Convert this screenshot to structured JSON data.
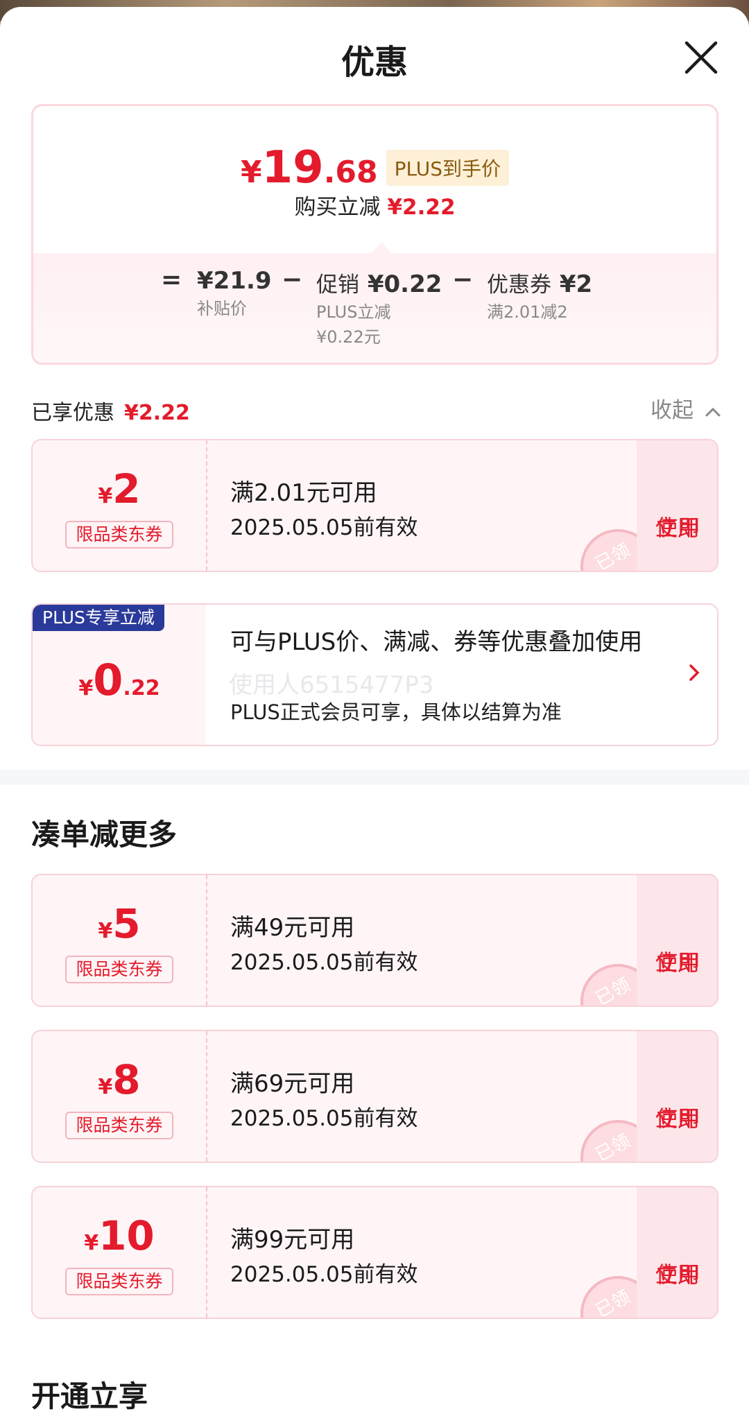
{
  "sheet": {
    "title": "优惠"
  },
  "price_card": {
    "final": {
      "currency": "¥",
      "int": "19",
      "dec": ".68"
    },
    "plus_tag": "PLUS到手价",
    "instant_label": "购买立减",
    "instant_value": "¥2.22",
    "breakdown": {
      "op1": "=",
      "subsidy_value": "¥21.9",
      "subsidy_label": "补贴价",
      "op2": "−",
      "promo_label": "促销",
      "promo_value": "¥0.22",
      "promo_sub1": "PLUS立减",
      "promo_sub2": "¥0.22元",
      "op3": "−",
      "coupon_label": "优惠券",
      "coupon_value": "¥2",
      "coupon_sub": "满2.01减2"
    }
  },
  "enjoyed": {
    "label": "已享优惠",
    "value": "¥2.22",
    "collapse_label": "收起"
  },
  "coupons_enjoyed": [
    {
      "currency": "¥",
      "amount": "2",
      "type": "限品类东券",
      "condition": "满2.01元可用",
      "validity": "2025.05.05前有效",
      "use_line1": "立即",
      "use_line2": "使用",
      "stamp": "已领"
    }
  ],
  "plus_offer": {
    "badge": "PLUS专享立减",
    "currency": "¥",
    "int": "0",
    "dec": ".22",
    "desc": "可与PLUS价、满减、券等优惠叠加使用",
    "desc2": "PLUS正式会员可享，具体以结算为准"
  },
  "watermark": "使用人6515477P3",
  "more_section": {
    "title": "凑单减更多"
  },
  "coupons_more": [
    {
      "currency": "¥",
      "amount": "5",
      "type": "限品类东券",
      "condition": "满49元可用",
      "validity": "2025.05.05前有效",
      "use_line1": "立即",
      "use_line2": "使用",
      "stamp": "已领"
    },
    {
      "currency": "¥",
      "amount": "8",
      "type": "限品类东券",
      "condition": "满69元可用",
      "validity": "2025.05.05前有效",
      "use_line1": "立即",
      "use_line2": "使用",
      "stamp": "已领"
    },
    {
      "currency": "¥",
      "amount": "10",
      "type": "限品类东券",
      "condition": "满99元可用",
      "validity": "2025.05.05前有效",
      "use_line1": "立即",
      "use_line2": "使用",
      "stamp": "已领"
    }
  ],
  "open_section": {
    "title": "开通立享"
  },
  "colors": {
    "accent_red": "#e31b2c",
    "plus_blue": "#2a3a9a",
    "coupon_bg": "#fff5f6"
  },
  "icons": {
    "close": "close-icon",
    "collapse": "chevron-up-icon",
    "more": "chevron-right-icon"
  }
}
